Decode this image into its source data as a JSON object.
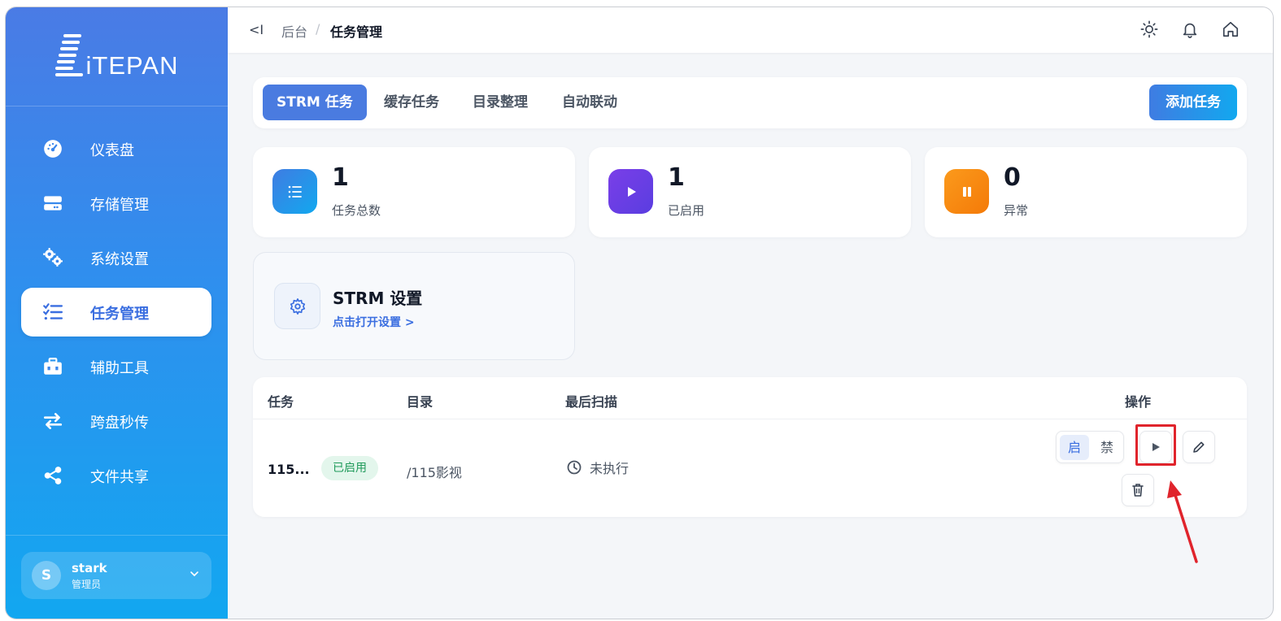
{
  "sidebar": {
    "logo_text": "iTEPAN",
    "items": [
      {
        "label": "仪表盘",
        "icon": "dashboard-icon"
      },
      {
        "label": "存储管理",
        "icon": "storage-icon"
      },
      {
        "label": "系统设置",
        "icon": "gears-icon"
      },
      {
        "label": "任务管理",
        "icon": "task-list-icon",
        "active": true
      },
      {
        "label": "辅助工具",
        "icon": "toolbox-icon"
      },
      {
        "label": "跨盘秒传",
        "icon": "transfer-icon"
      },
      {
        "label": "文件共享",
        "icon": "share-icon"
      }
    ],
    "user": {
      "initial": "S",
      "name": "stark",
      "role": "管理员"
    }
  },
  "topbar": {
    "collapse_label": "<I",
    "breadcrumb": [
      "后台",
      "任务管理"
    ],
    "separator": "/"
  },
  "tabs": [
    {
      "label": "STRM 任务",
      "active": true
    },
    {
      "label": "缓存任务"
    },
    {
      "label": "目录整理"
    },
    {
      "label": "自动联动"
    }
  ],
  "add_button": "添加任务",
  "stats": [
    {
      "value": "1",
      "label": "任务总数",
      "color": "#2f8fee"
    },
    {
      "value": "1",
      "label": "已启用",
      "color": "#6d3fe6"
    },
    {
      "value": "0",
      "label": "异常",
      "color": "#f98b12"
    }
  ],
  "settings_card": {
    "title": "STRM 设置",
    "link": "点击打开设置 >"
  },
  "table": {
    "headers": [
      "任务",
      "目录",
      "最后扫描",
      "操作"
    ],
    "rows": [
      {
        "task": "115...",
        "status": "已启用",
        "directory": "/115影视",
        "last_scan": "未执行",
        "toggle_on": "启",
        "toggle_off": "禁"
      }
    ]
  },
  "colors": {
    "accent": "#4a7be0",
    "highlight": "#e0242c"
  }
}
